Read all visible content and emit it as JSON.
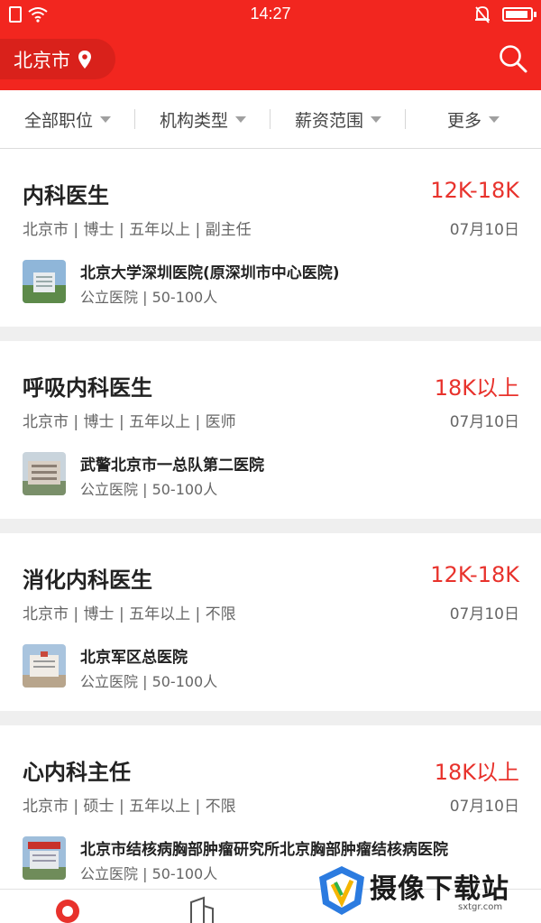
{
  "status_bar": {
    "time": "14:27"
  },
  "header": {
    "city": "北京市"
  },
  "filters": [
    {
      "label": "全部职位"
    },
    {
      "label": "机构类型"
    },
    {
      "label": "薪资范围"
    },
    {
      "label": "更多"
    }
  ],
  "jobs": [
    {
      "title": "内科医生",
      "salary": "12K-18K",
      "meta": "北京市 | 博士 | 五年以上 | 副主任",
      "date": "07月10日",
      "hospital": "北京大学深圳医院(原深圳市中心医院)",
      "hospital_meta": "公立医院 | 50-100人"
    },
    {
      "title": "呼吸内科医生",
      "salary": "18K以上",
      "meta": "北京市 | 博士 | 五年以上 | 医师",
      "date": "07月10日",
      "hospital": "武警北京市一总队第二医院",
      "hospital_meta": "公立医院 | 50-100人"
    },
    {
      "title": "消化内科医生",
      "salary": "12K-18K",
      "meta": "北京市 | 博士 | 五年以上 | 不限",
      "date": "07月10日",
      "hospital": "北京军区总医院",
      "hospital_meta": "公立医院 | 50-100人"
    },
    {
      "title": "心内科主任",
      "salary": "18K以上",
      "meta": "北京市 | 硕士 | 五年以上 | 不限",
      "date": "07月10日",
      "hospital": "北京市结核病胸部肿瘤研究所北京胸部肿瘤结核病医院",
      "hospital_meta": "公立医院 | 50-100人"
    }
  ],
  "watermark": {
    "text": "摄像下载站",
    "url": "sxtgr.com"
  },
  "colors": {
    "brand": "#f2261f",
    "salary": "#e8322c"
  }
}
